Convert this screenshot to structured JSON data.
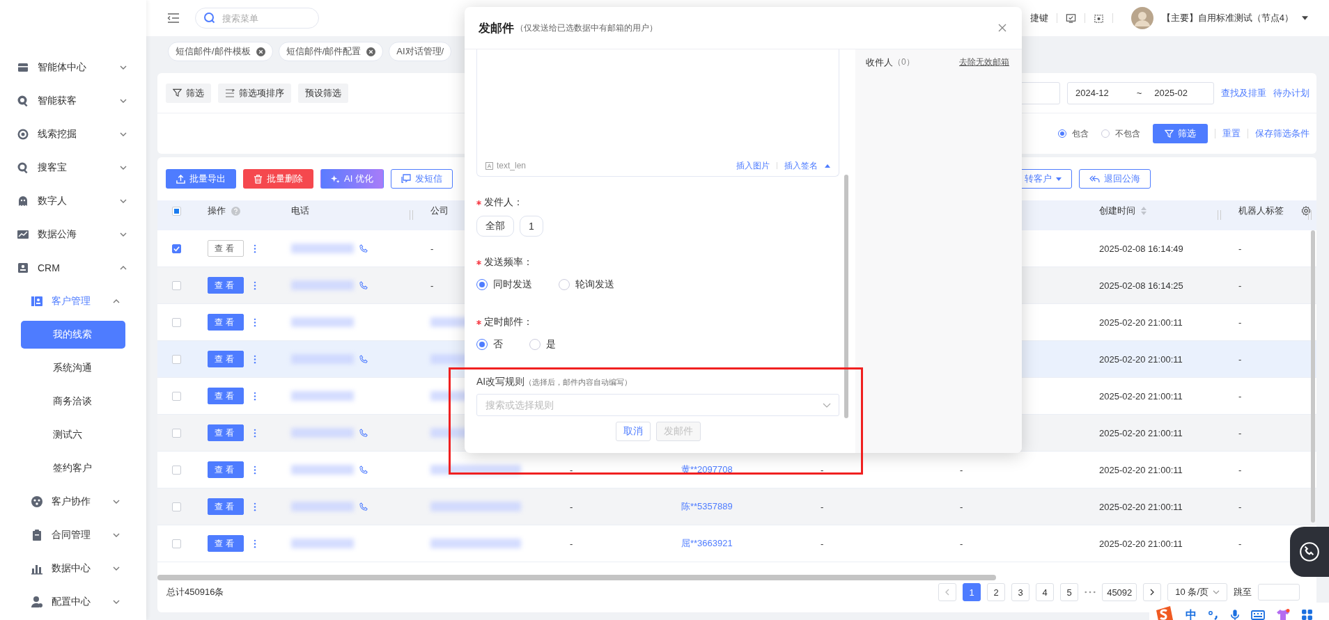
{
  "topbar": {
    "search_placeholder": "搜索菜单",
    "shortcut": "捷键",
    "account": "【主要】自用标准测试（节点4）"
  },
  "tabs": [
    {
      "label": "短信邮件/邮件模板",
      "closable": true
    },
    {
      "label": "短信邮件/邮件配置",
      "closable": true
    },
    {
      "label": "AI对话管理/",
      "closable": false
    }
  ],
  "sidebar": {
    "items": [
      {
        "label": "智能体中心",
        "expanded": false
      },
      {
        "label": "智能获客",
        "expanded": false
      },
      {
        "label": "线索挖掘",
        "expanded": false
      },
      {
        "label": "搜客宝",
        "expanded": false
      },
      {
        "label": "数字人",
        "expanded": false
      },
      {
        "label": "数据公海",
        "expanded": false
      },
      {
        "label": "CRM",
        "expanded": true,
        "children": [
          {
            "label": "客户管理",
            "expanded": true,
            "children": [
              {
                "label": "我的线索",
                "selected": true
              },
              {
                "label": "系统沟通",
                "selected": false
              },
              {
                "label": "商务洽谈",
                "selected": false
              },
              {
                "label": "测试六",
                "selected": false
              },
              {
                "label": "签约客户",
                "selected": false
              }
            ]
          },
          {
            "label": "客户协作",
            "expanded": false
          },
          {
            "label": "合同管理",
            "expanded": false
          },
          {
            "label": "数据中心",
            "expanded": false
          },
          {
            "label": "配置中心",
            "expanded": false
          }
        ]
      }
    ]
  },
  "filters": {
    "buttons": [
      "筛选",
      "筛选项排序",
      "预设筛选"
    ],
    "date_from": "2024-12",
    "date_sep": "~",
    "date_to": "2025-02",
    "links": [
      "查找及排重",
      "待办计划"
    ],
    "match_options": [
      {
        "label": "包含",
        "selected": true
      },
      {
        "label": "不包含",
        "selected": false
      }
    ],
    "apply": "筛选",
    "reset": "重置",
    "save": "保存筛选条件"
  },
  "toolbar": [
    {
      "label": "批量导出",
      "kind": "primary"
    },
    {
      "label": "批量删除",
      "kind": "danger"
    },
    {
      "label": "AI 优化",
      "kind": "ai"
    },
    {
      "label": "发短信",
      "kind": "sms"
    }
  ],
  "toolbar_right": [
    {
      "label": "转客户",
      "kind": "dropdown"
    },
    {
      "label": "退回公海",
      "kind": "return"
    }
  ],
  "table": {
    "select_all_partial": true,
    "columns": [
      {
        "label": "操作",
        "kind": "help"
      },
      {
        "label": "电话",
        "kind": "plain"
      },
      {
        "label": "公司",
        "kind": "plain"
      },
      {
        "label": "创建时间",
        "kind": "sort"
      },
      {
        "label": "机器人标签",
        "kind": "settings"
      }
    ],
    "rows": [
      {
        "checked": true,
        "highlighted": false,
        "view": "查看",
        "view_outlined": true,
        "call_icon": true,
        "company": "-",
        "created": "2025-02-08 16:14:49",
        "robot_tag": "-"
      },
      {
        "checked": false,
        "highlighted": false,
        "view": "查看",
        "view_outlined": false,
        "call_icon": true,
        "company": "-",
        "created": "2025-02-08 16:14:25",
        "robot_tag": "-"
      },
      {
        "checked": false,
        "highlighted": false,
        "view": "查看",
        "view_outlined": false,
        "call_icon": false,
        "created": "2025-02-20 21:00:11",
        "robot_tag": "-"
      },
      {
        "checked": false,
        "highlighted": true,
        "view": "查看",
        "view_outlined": false,
        "call_icon": true,
        "created": "2025-02-20 21:00:11",
        "robot_tag": "-"
      },
      {
        "checked": false,
        "highlighted": false,
        "view": "查看",
        "view_outlined": false,
        "call_icon": false,
        "created": "2025-02-20 21:00:11",
        "robot_tag": "-"
      },
      {
        "checked": false,
        "highlighted": false,
        "view": "查看",
        "view_outlined": false,
        "call_icon": true,
        "created": "2025-02-20 21:00:11",
        "robot_tag": "-"
      },
      {
        "checked": false,
        "highlighted": false,
        "view": "查看",
        "view_outlined": false,
        "call_icon": true,
        "column_5": "-",
        "contact": "黄**2097708",
        "column_7": "-",
        "column_8": "-",
        "created": "2025-02-20 21:00:11",
        "robot_tag": "-"
      },
      {
        "checked": false,
        "highlighted": false,
        "view": "查看",
        "view_outlined": false,
        "call_icon": true,
        "column_5": "-",
        "contact": "陈**5357889",
        "column_7": "-",
        "column_8": "-",
        "created": "2025-02-20 21:00:11",
        "robot_tag": "-"
      },
      {
        "checked": false,
        "highlighted": false,
        "view": "查看",
        "view_outlined": false,
        "call_icon": false,
        "column_5": "-",
        "contact": "屈**3663921",
        "column_7": "-",
        "column_8": "-",
        "created": "2025-02-20 21:00:11",
        "robot_tag": "-"
      }
    ]
  },
  "footer": {
    "total": "总计450916条",
    "pages": [
      {
        "label": "1",
        "selected": true
      },
      {
        "label": "2",
        "selected": false
      },
      {
        "label": "3",
        "selected": false
      },
      {
        "label": "4",
        "selected": false
      },
      {
        "label": "5",
        "selected": false
      }
    ],
    "last_page": "45092",
    "page_size": "10 条/页",
    "jump": "跳至"
  },
  "email_dialog": {
    "title": "发邮件",
    "note": "（仅发送给已选数据中有邮箱的用户）",
    "counter": "text_len",
    "insert_image": "插入图片",
    "insert_signature": "插入签名",
    "sender": {
      "label": "发件人：",
      "required": true,
      "options": [
        "全部",
        "1"
      ]
    },
    "frequency": {
      "label": "发送频率：",
      "required": true,
      "options": [
        {
          "label": "同时发送",
          "selected": true
        },
        {
          "label": "轮询发送",
          "selected": false
        }
      ]
    },
    "schedule": {
      "label": "定时邮件：",
      "required": true,
      "options": [
        {
          "label": "否",
          "selected": true
        },
        {
          "label": "是",
          "selected": false
        }
      ]
    },
    "ai_rule": {
      "label": "AI改写规则",
      "hint": "（选择后，邮件内容自动编写）",
      "placeholder": "搜索或选择规则"
    },
    "cancel": "取消",
    "send": {
      "label": "发邮件",
      "disabled": true
    },
    "recipients": {
      "label": "收件人",
      "count": "（0）",
      "remove_invalid": "去除无效邮箱"
    }
  },
  "annotation": {
    "kind": "frame"
  },
  "ime_bar": {
    "mode": "中"
  }
}
